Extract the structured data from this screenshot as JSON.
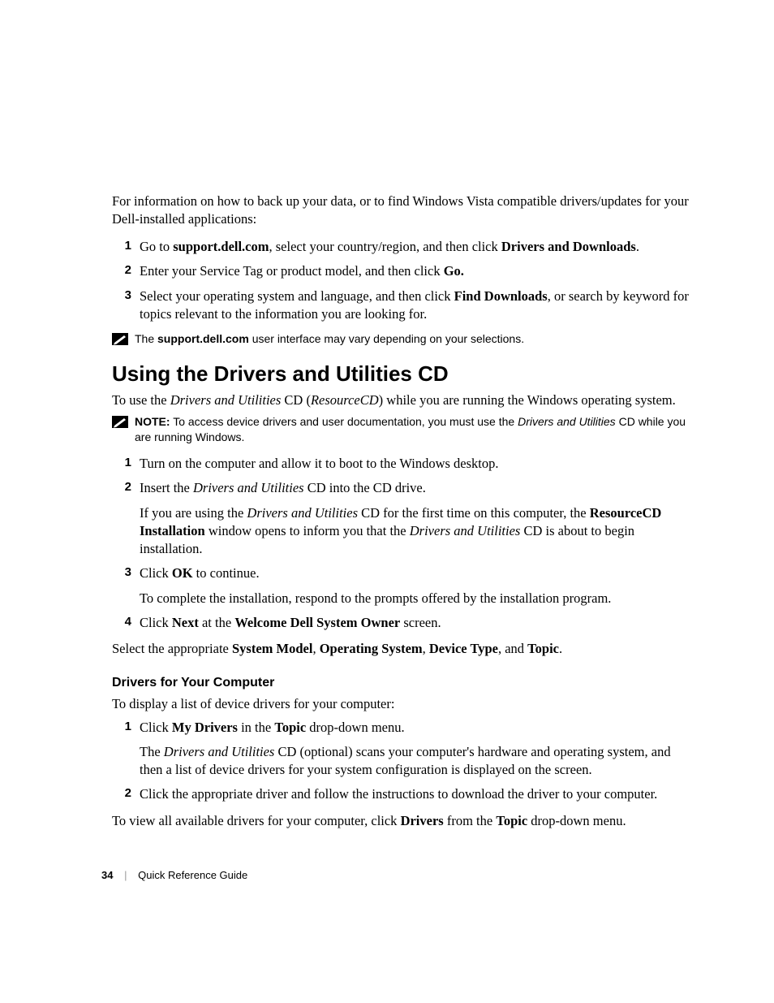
{
  "intro": {
    "text_before": "For information on how to back up your data, or to find Windows Vista compatible drivers/updates for your Dell-installed applications:"
  },
  "list1": {
    "items": [
      {
        "n": "1",
        "pre": "Go to ",
        "b1": "support.dell.com",
        "mid": ", select your country/region, and then click ",
        "b2": "Drivers and Downloads",
        "post": "."
      },
      {
        "n": "2",
        "pre": "Enter your Service Tag or product model, and then click ",
        "b1": "Go.",
        "post": ""
      },
      {
        "n": "3",
        "pre": "Select your operating system and language, and then click ",
        "b1": "Find Downloads",
        "post": ", or search by keyword for topics relevant to the information you are looking for."
      }
    ]
  },
  "note1": {
    "pre": "The ",
    "b": "support.dell.com",
    "post": " user interface may vary depending on your selections."
  },
  "heading": "Using the Drivers and Utilities CD",
  "p_after_heading": {
    "pre": "To use the ",
    "i1": "Drivers and Utilities",
    "mid1": " CD (",
    "i2": "ResourceCD",
    "post": ") while you are running the Windows operating system."
  },
  "note2": {
    "label": "NOTE:",
    "pre": " To access device drivers and user documentation, you must use the ",
    "i": "Drivers and Utilities",
    "post": " CD while you are running Windows."
  },
  "list2": {
    "items": [
      {
        "n": "1",
        "text": "Turn on the computer and allow it to boot to the Windows desktop."
      },
      {
        "n": "2",
        "line1_pre": "Insert the ",
        "line1_i": "Drivers and Utilities",
        "line1_post": " CD into the CD drive.",
        "extra_pre": "If you are using the ",
        "extra_i1": "Drivers and Utilities",
        "extra_mid1": " CD for the first time on this computer, the ",
        "extra_b1": "ResourceCD Installation",
        "extra_mid2": " window opens to inform you that the ",
        "extra_i2": "Drivers and Utilities",
        "extra_post": " CD is about to begin installation."
      },
      {
        "n": "3",
        "line1_pre": "Click ",
        "line1_b": "OK",
        "line1_post": " to continue.",
        "extra_text": "To complete the installation, respond to the prompts offered by the installation program."
      },
      {
        "n": "4",
        "line1_pre": "Click ",
        "line1_b1": "Next",
        "line1_mid": " at the ",
        "line1_b2": "Welcome Dell System Owner",
        "line1_post": " screen."
      }
    ]
  },
  "p_select": {
    "pre": "Select the appropriate ",
    "b1": "System Model",
    "c1": ", ",
    "b2": "Operating System",
    "c2": ", ",
    "b3": "Device Type",
    "c3": ", and ",
    "b4": "Topic",
    "post": "."
  },
  "sub_heading": "Drivers for Your Computer",
  "p_display": "To display a list of device drivers for your computer:",
  "list3": {
    "items": [
      {
        "n": "1",
        "line1_pre": "Click ",
        "line1_b1": "My Drivers",
        "line1_mid": " in the ",
        "line1_b2": "Topic",
        "line1_post": " drop-down menu.",
        "extra_pre": "The ",
        "extra_i": "Drivers and Utilities",
        "extra_post": " CD (optional) scans your computer's hardware and operating system, and then a list of device drivers for your system configuration is displayed on the screen."
      },
      {
        "n": "2",
        "text": "Click the appropriate driver and follow the instructions to download the driver to your computer."
      }
    ]
  },
  "p_view_all": {
    "pre": "To view all available drivers for your computer, click ",
    "b1": "Drivers",
    "mid": " from the ",
    "b2": "Topic",
    "post": " drop-down menu."
  },
  "footer": {
    "page": "34",
    "title": "Quick Reference Guide"
  }
}
